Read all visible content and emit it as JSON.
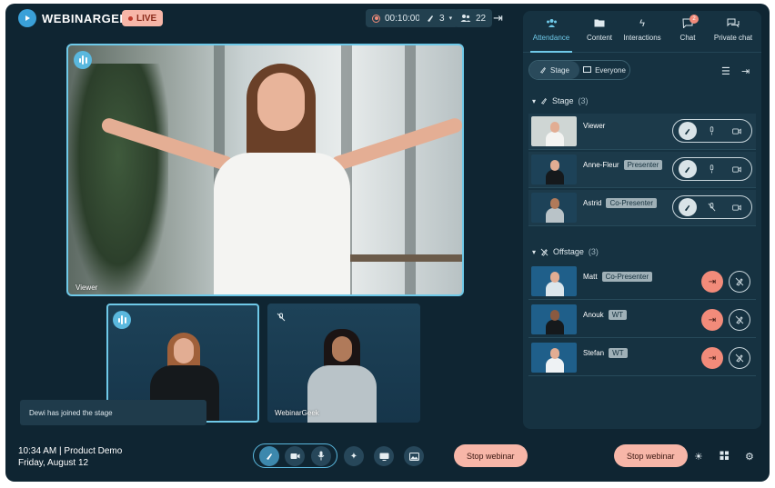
{
  "brand": {
    "name": "WEBINARGEEK"
  },
  "status": {
    "live_label": "LIVE",
    "timer": "00:10:00",
    "hands_count": "3",
    "attendee_count": "22"
  },
  "stage_video": {
    "label": "Viewer"
  },
  "small_videos": [
    {
      "label": ""
    },
    {
      "label": "WebinarGeek"
    }
  ],
  "toast": {
    "text": "Dewi has joined the stage"
  },
  "session": {
    "line1": "10:34 AM | Product Demo",
    "line2": "Friday, August 12"
  },
  "bottom": {
    "stop_center": "Stop webinar",
    "stop_right": "Stop webinar"
  },
  "panel": {
    "tabs": [
      {
        "label": "Attendance",
        "icon": "people-icon",
        "active": true
      },
      {
        "label": "Content",
        "icon": "folder-icon"
      },
      {
        "label": "Interactions",
        "icon": "lightning-icon"
      },
      {
        "label": "Chat",
        "icon": "chat-icon",
        "badge": "2"
      },
      {
        "label": "Private chat",
        "icon": "private-chat-icon"
      }
    ],
    "segments": [
      {
        "label": "Stage",
        "active": true
      },
      {
        "label": "Everyone"
      }
    ],
    "stage": {
      "title": "Stage",
      "count": "(3)",
      "rows": [
        {
          "name": "Viewer",
          "role": ""
        },
        {
          "name": "Anne-Fleur",
          "role": "Presenter"
        },
        {
          "name": "Astrid",
          "role": "Co-Presenter"
        }
      ]
    },
    "offstage": {
      "title": "Offstage",
      "count": "(3)",
      "rows": [
        {
          "name": "Matt",
          "role": "Co-Presenter"
        },
        {
          "name": "Anouk",
          "role": "WT"
        },
        {
          "name": "Stefan",
          "role": "WT"
        }
      ]
    }
  },
  "colors": {
    "accent": "#6fc9e8",
    "background": "#0f2532",
    "panel": "#163241",
    "danger": "#f7b6a8"
  }
}
